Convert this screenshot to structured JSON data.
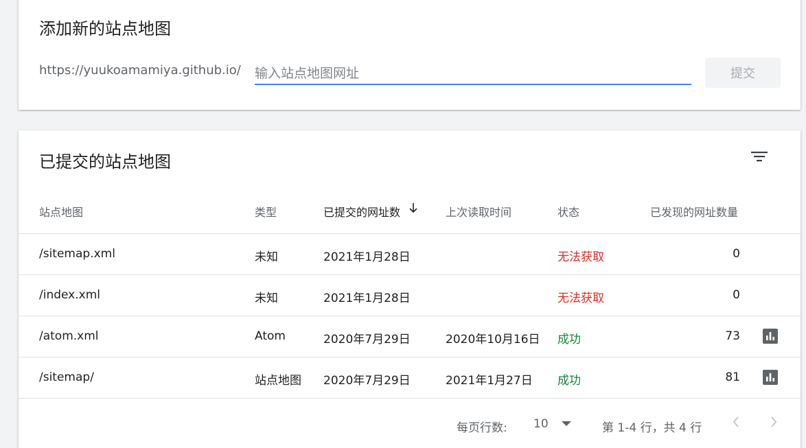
{
  "add_card": {
    "title": "添加新的站点地图",
    "url_prefix": "https://yuukoamamiya.github.io/",
    "input_value": "",
    "input_placeholder": "输入站点地图网址",
    "submit_label": "提交"
  },
  "list_card": {
    "title": "已提交的站点地图",
    "filter_icon": "filter-icon",
    "columns": [
      "站点地图",
      "类型",
      "已提交的网址数",
      "上次读取时间",
      "状态",
      "已发现的网址数量"
    ],
    "sorted_column": "已提交的网址数",
    "sort_direction": "descending",
    "rows": [
      {
        "sitemap": "/sitemap.xml",
        "type": "未知",
        "submitted": "2021年1月28日",
        "last_read": "",
        "status": "无法获取",
        "status_kind": "error",
        "discovered": "0",
        "has_chart": false
      },
      {
        "sitemap": "/index.xml",
        "type": "未知",
        "submitted": "2021年1月28日",
        "last_read": "",
        "status": "无法获取",
        "status_kind": "error",
        "discovered": "0",
        "has_chart": false
      },
      {
        "sitemap": "/atom.xml",
        "type": "Atom",
        "submitted": "2020年7月29日",
        "last_read": "2020年10月16日",
        "status": "成功",
        "status_kind": "ok",
        "discovered": "73",
        "has_chart": true
      },
      {
        "sitemap": "/sitemap/",
        "type": "站点地图",
        "submitted": "2020年7月29日",
        "last_read": "2021年1月27日",
        "status": "成功",
        "status_kind": "ok",
        "discovered": "81",
        "has_chart": true
      }
    ],
    "pagination": {
      "rows_per_page_label": "每页行数:",
      "rows_per_page_value": "10",
      "range_text": "第 1-4 行，共 4 行"
    }
  },
  "colors": {
    "accent": "#4285f4",
    "error": "#d93025",
    "success": "#188038",
    "background": "#f1f3f4"
  }
}
